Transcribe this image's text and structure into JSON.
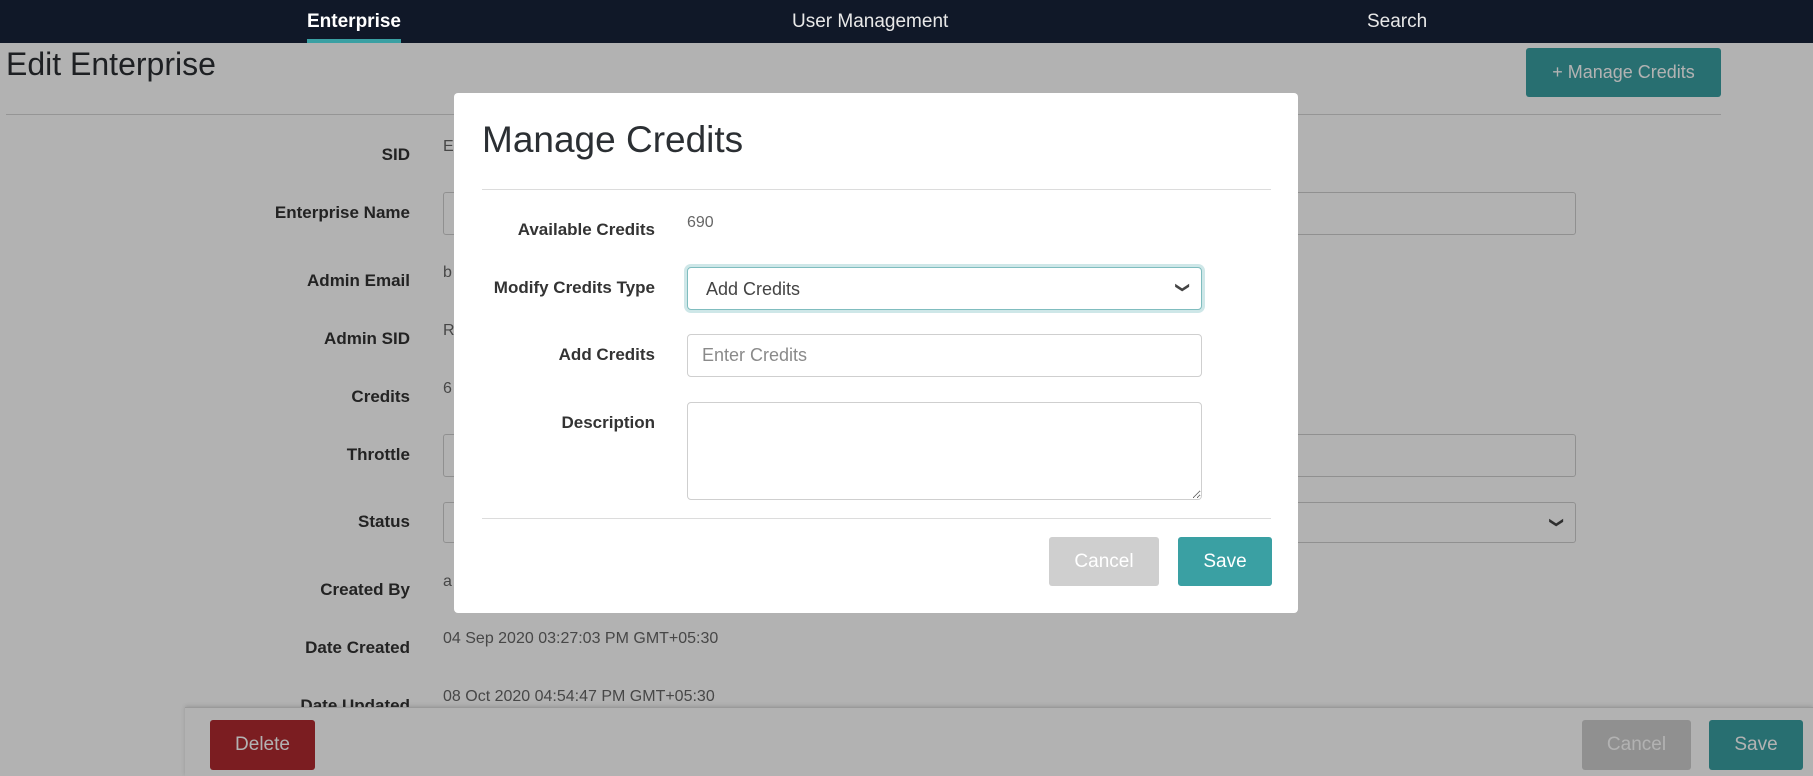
{
  "nav": {
    "items": [
      {
        "label": "Enterprise"
      },
      {
        "label": "User Management"
      },
      {
        "label": "Search"
      }
    ]
  },
  "page": {
    "title": "Edit Enterprise",
    "manage_credits_label": "+ Manage Credits",
    "fields": {
      "sid": {
        "label": "SID",
        "value": "E"
      },
      "enterprise_name": {
        "label": "Enterprise Name"
      },
      "admin_email": {
        "label": "Admin Email",
        "value": "b"
      },
      "admin_sid": {
        "label": "Admin SID",
        "value": "R"
      },
      "credits": {
        "label": "Credits",
        "value": "6"
      },
      "throttle": {
        "label": "Throttle"
      },
      "status": {
        "label": "Status"
      },
      "created_by": {
        "label": "Created By",
        "value": "a"
      },
      "date_created": {
        "label": "Date Created",
        "value": "04 Sep 2020 03:27:03 PM GMT+05:30"
      },
      "date_updated": {
        "label": "Date Updated",
        "value": "08 Oct 2020 04:54:47 PM GMT+05:30"
      }
    },
    "actions": {
      "delete_label": "Delete",
      "cancel_label": "Cancel",
      "save_label": "Save"
    }
  },
  "modal": {
    "title": "Manage Credits",
    "available_credits_label": "Available Credits",
    "available_credits_value": "690",
    "modify_type_label": "Modify Credits Type",
    "modify_type_value": "Add Credits",
    "add_credits_label": "Add Credits",
    "add_credits_placeholder": "Enter Credits",
    "description_label": "Description",
    "cancel_label": "Cancel",
    "save_label": "Save"
  },
  "colors": {
    "accent": "#3aa0a3",
    "nav_bg": "#101828",
    "danger": "#b02a30"
  }
}
